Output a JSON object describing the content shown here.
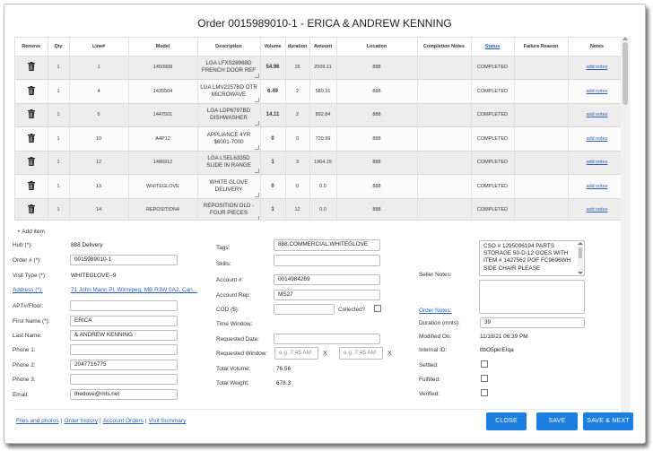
{
  "title": "Order 0015989010-1 - ERICA & ANDREW KENNING",
  "table": {
    "headers": {
      "remove": "Remove",
      "qty": "Qty",
      "line": "Line#",
      "model": "Model",
      "description": "Description",
      "volume": "Volume",
      "duration": "duration",
      "amount": "Amount",
      "location": "Location",
      "completion_notes": "Completion Notes",
      "status": "Status",
      "failure_reason": "Failure Reason",
      "notes": "Notes"
    },
    "rows": [
      {
        "qty": "1",
        "line": "1",
        "model": "1450908",
        "desc1": "LGA LFXS28968D",
        "desc2": "FRENCH DOOR REF",
        "volume": "54.96",
        "duration": "15",
        "amount": "2509.11",
        "location": "888",
        "status": "COMPLETED",
        "notes": "add notes"
      },
      {
        "qty": "1",
        "line": "4",
        "model": "1435504",
        "desc1": "LGA LMV2257BD OTR",
        "desc2": "MICROWAVE",
        "volume": "6.49",
        "duration": "2",
        "amount": "580.31",
        "location": "888",
        "status": "COMPLETED",
        "notes": "add notes"
      },
      {
        "qty": "1",
        "line": "6",
        "model": "1447501",
        "desc1": "LGA LDP6797BD",
        "desc2": "DISHWASHER",
        "volume": "14.11",
        "duration": "2",
        "amount": "892.84",
        "location": "888",
        "status": "COMPLETED",
        "notes": "add notes"
      },
      {
        "qty": "1",
        "line": "10",
        "model": "A4P12",
        "desc1": "APPLIANCE 4YR",
        "desc2": "$6001-7000",
        "volume": "0",
        "duration": "0",
        "amount": "729.99",
        "location": "888",
        "status": "COMPLETED",
        "notes": "add notes"
      },
      {
        "qty": "1",
        "line": "12",
        "model": "1486912",
        "desc1": "LGA LSEL6335D",
        "desc2": "SLIDE IN RANGE",
        "volume": "1",
        "duration": "3",
        "amount": "1964.15",
        "location": "888",
        "status": "COMPLETED",
        "notes": "add notes"
      },
      {
        "qty": "1",
        "line": "13",
        "model": "WHITEGLOVE",
        "desc1": "WHITE GLOVE",
        "desc2": "DELIVERY",
        "volume": "0",
        "duration": "0",
        "amount": "0.0",
        "location": "888",
        "status": "COMPLETED",
        "notes": "add notes"
      },
      {
        "qty": "1",
        "line": "14",
        "model": "REPOSITION4",
        "desc1": "REPOSITION OLD -",
        "desc2": "FOUR PIECES",
        "volume": "1",
        "duration": "12",
        "amount": "0.0",
        "location": "888",
        "status": "COMPLETED",
        "notes": "add notes"
      }
    ]
  },
  "add_item": "+ Add item",
  "left": {
    "hub_label": "Hub (*):",
    "hub_value": "888 Delivery",
    "order_label": "Order # (*):",
    "order_value": "0015989010-1",
    "visit_type_label": "Visit Type (*):",
    "visit_type_value": "WHITEGLOVE--9",
    "address_label": "Address (*):",
    "address_value": "71 John Mann Pl, Winnipeg, MB R3W 0A2, Can...",
    "apt_label": "APT#/Floor:",
    "apt_value": "",
    "first_name_label": "First Name (*):",
    "first_name_value": "ERICA",
    "last_name_label": "Last Name:",
    "last_name_value": "& ANDREW KENNING",
    "phone1_label": "Phone 1:",
    "phone1_value": "",
    "phone2_label": "Phone 2:",
    "phone2_value": "2047716775",
    "phone3_label": "Phone 3:",
    "phone3_value": "",
    "email_label": "Email:",
    "email_value": "thedove@mts.net"
  },
  "middle": {
    "tags_label": "Tags:",
    "tags_value": "888,COMMERCIAL,WHITEGLOVE",
    "skills_label": "Skills:",
    "skills_value": "",
    "account_label": "Account #:",
    "account_value": "0014984269",
    "account_rep_label": "Account Rep:",
    "account_rep_value": "MS27",
    "cod_label": "COD ($):",
    "cod_value": "",
    "collected_label": "Collected?",
    "time_window_label": "Time Window:",
    "requested_date_label": "Requested Date:",
    "requested_date_value": "",
    "requested_window_label": "Requested Window:",
    "window_start_placeholder": "e.g. 7:45 AM",
    "window_end_placeholder": "e.g. 7:45 AM",
    "clear_symbol": "X",
    "total_volume_label": "Total Volume:",
    "total_volume_value": "76.56",
    "total_weight_label": "Total Weight:",
    "total_weight_value": "678.3"
  },
  "right": {
    "seller_notes_label": "Seller Notes:",
    "seller_notes_lines": [
      "CSO # 1295006194 PARTS",
      "STORAGE 50-D-12 GOES WITH",
      "ITEM # 1427562 POF FC9696WH",
      "SIDE CHAIR PLEASE"
    ],
    "order_notes_label": "Order Notes:",
    "order_notes_value": "",
    "duration_label": "Duration (mnts):",
    "duration_value": "39",
    "modified_label": "Modified On:",
    "modified_value": "11/18/21 06:39 PM",
    "internal_label": "Internal ID:",
    "internal_value": "ttbO5pkrEIqa",
    "settled_label": "Settled:",
    "fulfilled_label": "Fulfilled:",
    "verified_label": "Verified:"
  },
  "footer": {
    "links": [
      "Files and photos",
      "Order history",
      "Account Orders",
      "Visit Summary"
    ],
    "separator": "|",
    "close": "CLOSE",
    "save": "SAVE",
    "save_next": "SAVE & NEXT"
  },
  "colors": {
    "accent": "#1c7fe0",
    "link": "#2b5fbd",
    "row_shade": "#ececec"
  }
}
